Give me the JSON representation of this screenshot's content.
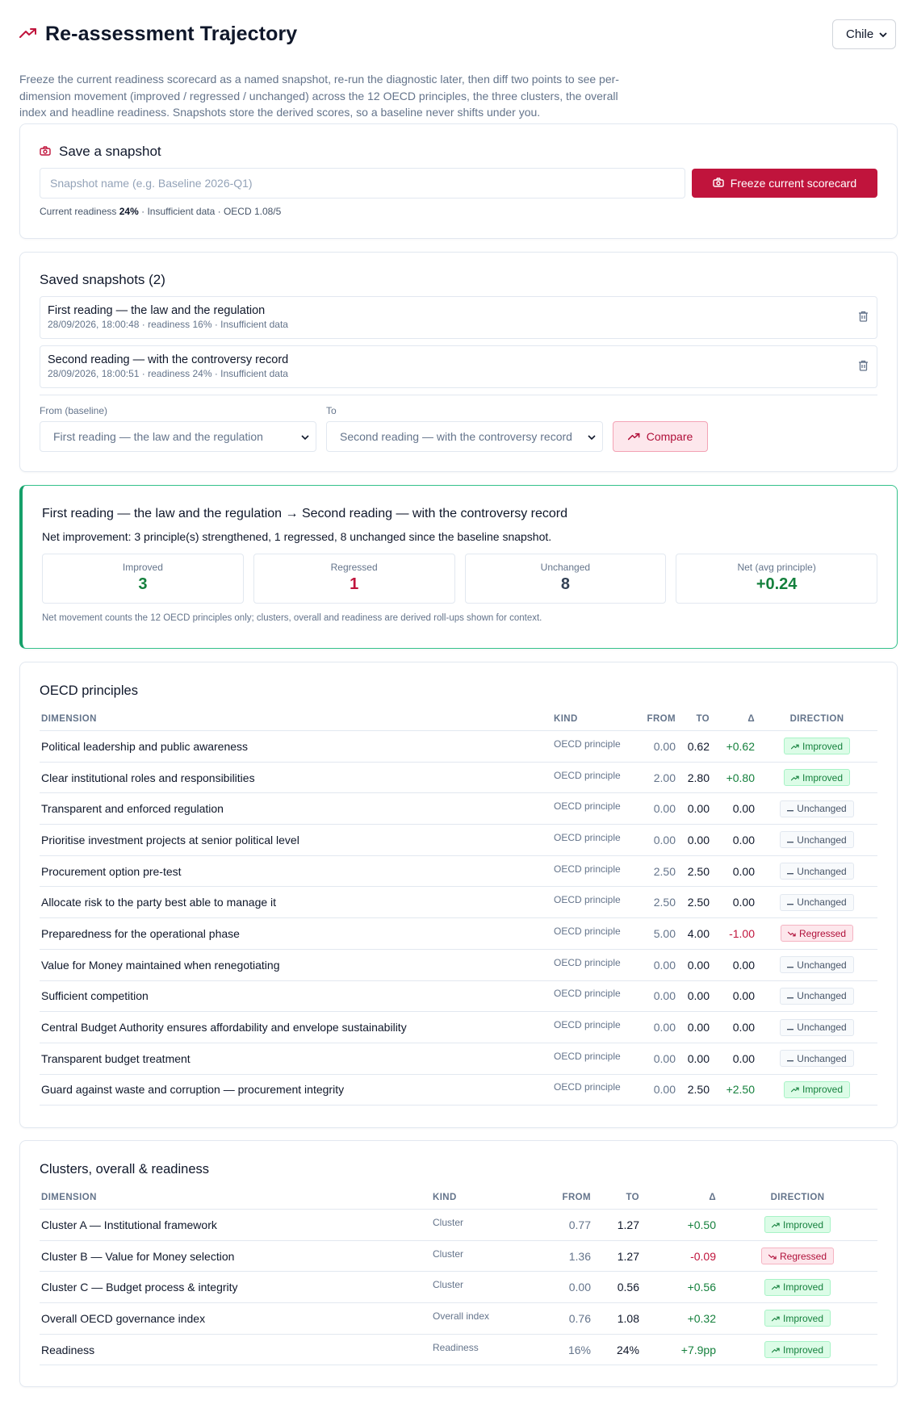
{
  "header": {
    "title": "Re-assessment Trajectory",
    "country": "Chile",
    "intro": "Freeze the current readiness scorecard as a named snapshot, re-run the diagnostic later, then diff two points to see per-dimension movement (improved / regressed / unchanged) across the 12 OECD principles, the three clusters, the overall index and headline readiness. Snapshots store the derived scores, so a baseline never shifts under you."
  },
  "save": {
    "title": "Save a snapshot",
    "placeholder": "Snapshot name (e.g. Baseline 2026-Q1)",
    "button": "Freeze current scorecard",
    "meta_prefix": "Current readiness",
    "readiness": "24%",
    "meta_suffix": "· Insufficient data · OECD 1.08/5"
  },
  "saved": {
    "title": "Saved snapshots (2)",
    "items": [
      {
        "name": "First reading — the law and the regulation",
        "meta": "28/09/2026, 18:00:48 · readiness 16% · Insufficient data"
      },
      {
        "name": "Second reading — with the controversy record",
        "meta": "28/09/2026, 18:00:51 · readiness 24% · Insufficient data"
      }
    ],
    "from_label": "From (baseline)",
    "from_value": "First reading — the law and the regulation",
    "to_label": "To",
    "to_value": "Second reading — with the controversy record",
    "compare": "Compare"
  },
  "summary": {
    "title": "First reading — the law and the regulation → Second reading — with the controversy record",
    "subtitle": "Net improvement: 3 principle(s) strengthened, 1 regressed, 8 unchanged since the baseline snapshot.",
    "stats": [
      {
        "label": "Improved",
        "value": "3"
      },
      {
        "label": "Regressed",
        "value": "1"
      },
      {
        "label": "Unchanged",
        "value": "8"
      },
      {
        "label": "Net (avg principle)",
        "value": "+0.24"
      }
    ],
    "note": "Net movement counts the 12 OECD principles only; clusters, overall and readiness are derived roll-ups shown for context."
  },
  "principles": {
    "title": "OECD principles",
    "columns": [
      "Dimension",
      "Kind",
      "From",
      "To",
      "Δ",
      "Direction"
    ],
    "rows": [
      {
        "dimension": "Political leadership and public awareness",
        "kind": "OECD principle",
        "from": "0.00",
        "to": "0.62",
        "delta": "+0.62",
        "direction": "Improved"
      },
      {
        "dimension": "Clear institutional roles and responsibilities",
        "kind": "OECD principle",
        "from": "2.00",
        "to": "2.80",
        "delta": "+0.80",
        "direction": "Improved"
      },
      {
        "dimension": "Transparent and enforced regulation",
        "kind": "OECD principle",
        "from": "0.00",
        "to": "0.00",
        "delta": "0.00",
        "direction": "Unchanged"
      },
      {
        "dimension": "Prioritise investment projects at senior political level",
        "kind": "OECD principle",
        "from": "0.00",
        "to": "0.00",
        "delta": "0.00",
        "direction": "Unchanged"
      },
      {
        "dimension": "Procurement option pre-test",
        "kind": "OECD principle",
        "from": "2.50",
        "to": "2.50",
        "delta": "0.00",
        "direction": "Unchanged"
      },
      {
        "dimension": "Allocate risk to the party best able to manage it",
        "kind": "OECD principle",
        "from": "2.50",
        "to": "2.50",
        "delta": "0.00",
        "direction": "Unchanged"
      },
      {
        "dimension": "Preparedness for the operational phase",
        "kind": "OECD principle",
        "from": "5.00",
        "to": "4.00",
        "delta": "-1.00",
        "direction": "Regressed"
      },
      {
        "dimension": "Value for Money maintained when renegotiating",
        "kind": "OECD principle",
        "from": "0.00",
        "to": "0.00",
        "delta": "0.00",
        "direction": "Unchanged"
      },
      {
        "dimension": "Sufficient competition",
        "kind": "OECD principle",
        "from": "0.00",
        "to": "0.00",
        "delta": "0.00",
        "direction": "Unchanged"
      },
      {
        "dimension": "Central Budget Authority ensures affordability and envelope sustainability",
        "kind": "OECD principle",
        "from": "0.00",
        "to": "0.00",
        "delta": "0.00",
        "direction": "Unchanged"
      },
      {
        "dimension": "Transparent budget treatment",
        "kind": "OECD principle",
        "from": "0.00",
        "to": "0.00",
        "delta": "0.00",
        "direction": "Unchanged"
      },
      {
        "dimension": "Guard against waste and corruption — procurement integrity",
        "kind": "OECD principle",
        "from": "0.00",
        "to": "2.50",
        "delta": "+2.50",
        "direction": "Improved"
      }
    ]
  },
  "clusters": {
    "title": "Clusters, overall & readiness",
    "columns": [
      "Dimension",
      "Kind",
      "From",
      "To",
      "Δ",
      "Direction"
    ],
    "rows": [
      {
        "dimension": "Cluster A — Institutional framework",
        "kind": "Cluster",
        "from": "0.77",
        "to": "1.27",
        "delta": "+0.50",
        "direction": "Improved"
      },
      {
        "dimension": "Cluster B — Value for Money selection",
        "kind": "Cluster",
        "from": "1.36",
        "to": "1.27",
        "delta": "-0.09",
        "direction": "Regressed"
      },
      {
        "dimension": "Cluster C — Budget process & integrity",
        "kind": "Cluster",
        "from": "0.00",
        "to": "0.56",
        "delta": "+0.56",
        "direction": "Improved"
      },
      {
        "dimension": "Overall OECD governance index",
        "kind": "Overall index",
        "from": "0.76",
        "to": "1.08",
        "delta": "+0.32",
        "direction": "Improved"
      },
      {
        "dimension": "Readiness",
        "kind": "Readiness",
        "from": "16%",
        "to": "24%",
        "delta": "+7.9pp",
        "direction": "Improved"
      }
    ]
  },
  "colors": {
    "accent": "#c0143c",
    "improved": "#15803d",
    "regressed": "#c0143c",
    "summary_border": "#16a06a"
  }
}
